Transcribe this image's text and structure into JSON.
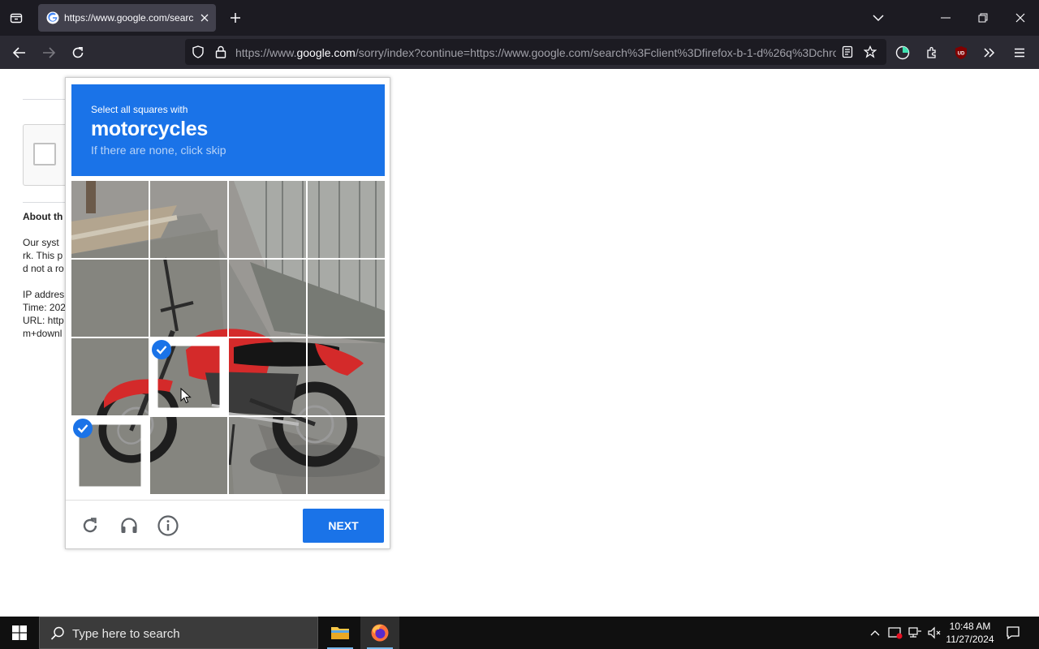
{
  "browser": {
    "tab_title": "https://www.google.com/search",
    "url_prefix": "https://www.",
    "url_domain": "google.com",
    "url_rest": "/sorry/index?continue=https://www.google.com/search%3Fclient%3Dfirefox-b-1-d%26q%3Dchro",
    "addon_label": "UD"
  },
  "page": {
    "about_heading": "About th",
    "para_lines": [
      "Our syst",
      "rk. This p",
      "d not a ro"
    ],
    "info_lines": [
      "IP addres",
      "Time: 202",
      "URL: http",
      "m+downl"
    ]
  },
  "captcha": {
    "instruction": "Select all squares with",
    "target": "motorcycles",
    "hint": "If there are none, click skip",
    "next_label": "NEXT",
    "selected_tiles": [
      9,
      12
    ]
  },
  "taskbar": {
    "search_placeholder": "Type here to search",
    "time": "10:48 AM",
    "date": "11/27/2024"
  },
  "colors": {
    "accent": "#1a73e8",
    "motorcycle_red": "#d42a2a"
  }
}
